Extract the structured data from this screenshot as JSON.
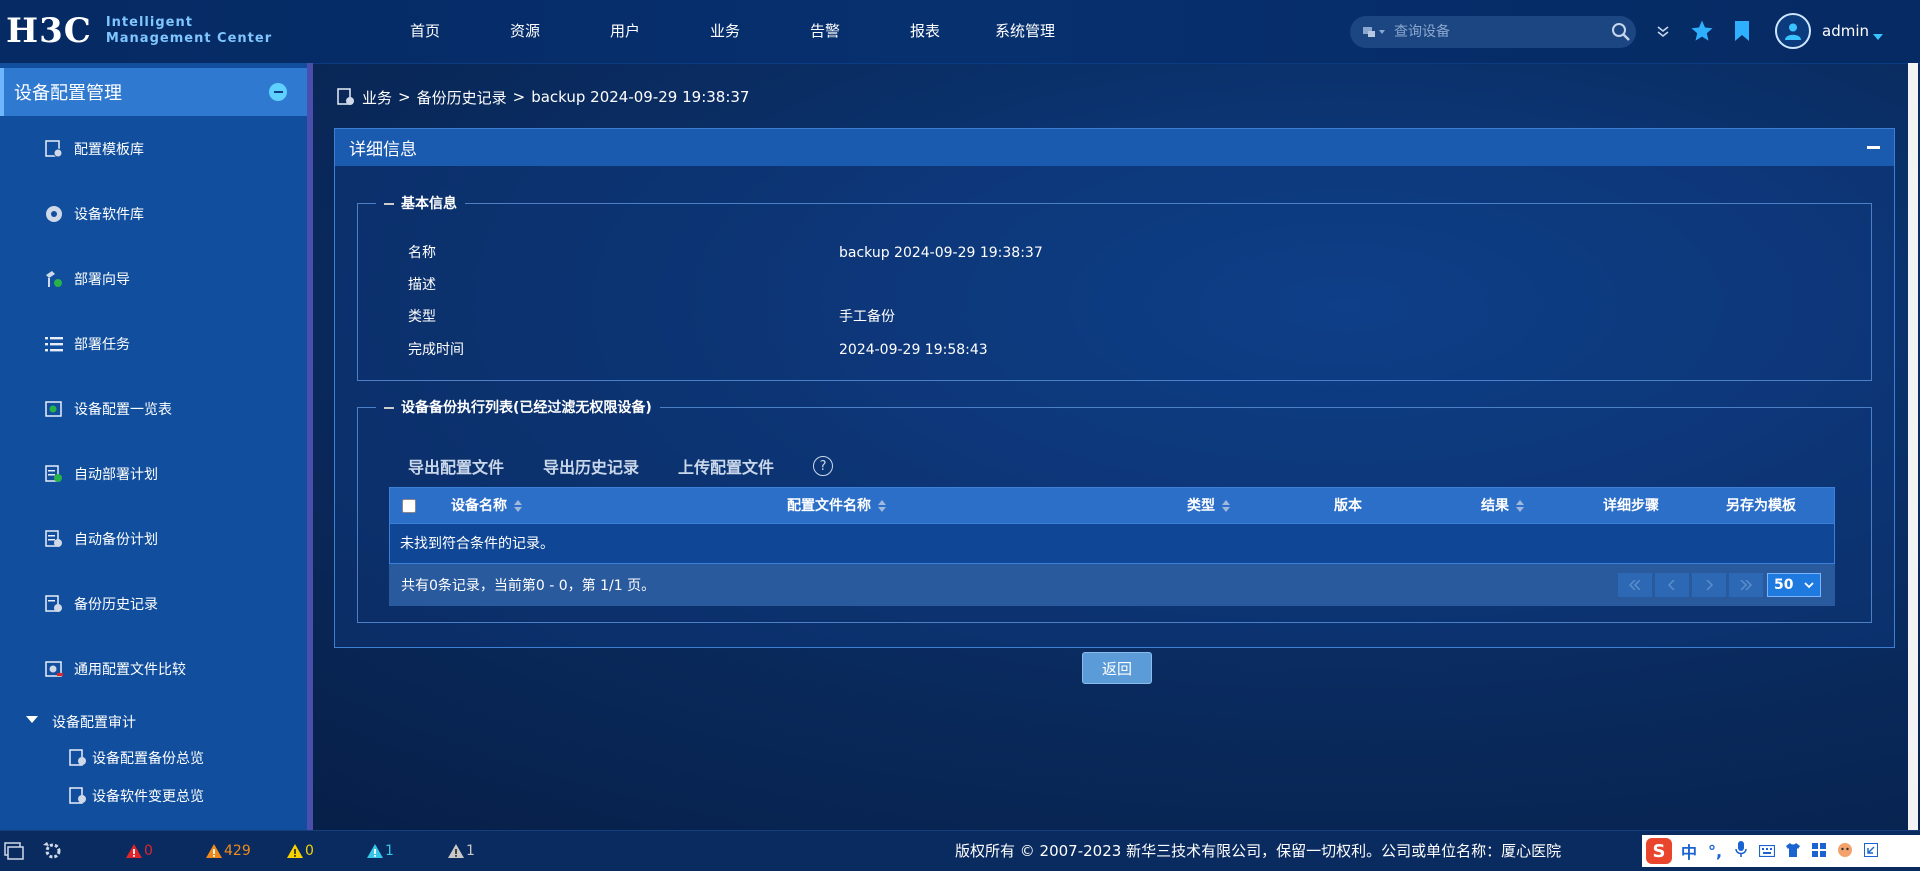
{
  "app": {
    "logo_text": "H3C",
    "logo_sub_line1": "Intelligent",
    "logo_sub_line2": "Management Center"
  },
  "nav": [
    "首页",
    "资源",
    "用户",
    "业务",
    "告警",
    "报表",
    "系统管理"
  ],
  "search": {
    "placeholder": "查询设备"
  },
  "user": {
    "name": "admin"
  },
  "sidebar": {
    "title": "设备配置管理",
    "items": [
      "配置模板库",
      "设备软件库",
      "部署向导",
      "部署任务",
      "设备配置一览表",
      "自动部署计划",
      "自动备份计划",
      "备份历史记录",
      "通用配置文件比较"
    ],
    "group": "设备配置审计",
    "sub_items": [
      "设备配置备份总览",
      "设备软件变更总览"
    ]
  },
  "breadcrumb": {
    "part1": "业务",
    "part2": "备份历史记录",
    "part3": "backup 2024-09-29 19:38:37",
    "separator": ">"
  },
  "panel": {
    "title": "详细信息",
    "basic": {
      "legend": "基本信息",
      "rows": [
        {
          "label": "名称",
          "value": "backup 2024-09-29 19:38:37"
        },
        {
          "label": "描述",
          "value": ""
        },
        {
          "label": "类型",
          "value": "手工备份"
        },
        {
          "label": "完成时间",
          "value": "2024-09-29 19:58:43"
        }
      ]
    },
    "list": {
      "legend": "设备备份执行列表(已经过滤无权限设备)",
      "toolbar": [
        "导出配置文件",
        "导出历史记录",
        "上传配置文件"
      ],
      "help": "?",
      "columns": [
        "设备名称",
        "配置文件名称",
        "类型",
        "版本",
        "结果",
        "详细步骤",
        "另存为模板"
      ],
      "empty_text": "未找到符合条件的记录。",
      "summary": "共有0条记录，当前第0 - 0，第 1/1 页。",
      "page_size": "50"
    }
  },
  "back_button": "返回",
  "status": {
    "critical": "0",
    "major": "429",
    "minor": "0",
    "warning": "1",
    "info": "1",
    "copyright": "版权所有 © 2007-2023 新华三技术有限公司，保留一切权利。公司或单位名称：厦心医院"
  },
  "ime": {
    "logo": "S",
    "lang": "中",
    "punct": "°,"
  },
  "colors": {
    "critical": "#e0262b",
    "major": "#f08a1c",
    "minor": "#f6d200",
    "warning": "#38c6e8",
    "info": "#c8c8c8",
    "accent": "#2f7ad0"
  }
}
